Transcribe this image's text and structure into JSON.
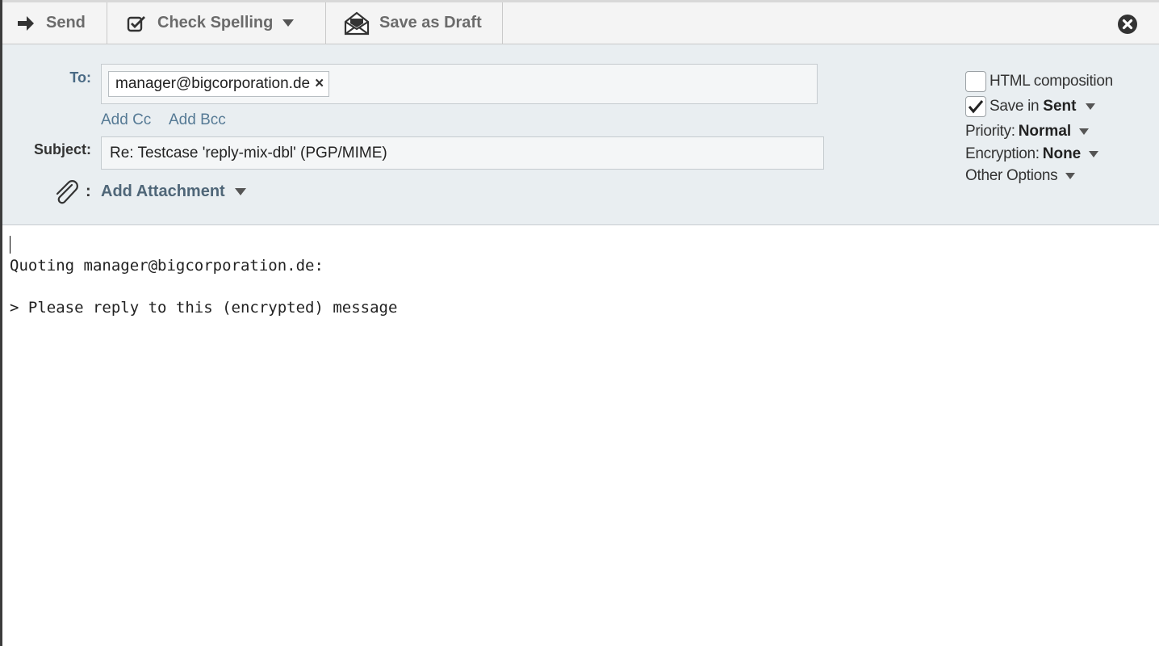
{
  "toolbar": {
    "send_label": "Send",
    "spell_label": "Check Spelling",
    "draft_label": "Save as Draft"
  },
  "header": {
    "to_label": "To:",
    "recipients": [
      "manager@bigcorporation.de"
    ],
    "remove_glyph": "×",
    "add_cc": "Add Cc",
    "add_bcc": "Add Bcc",
    "subject_label": "Subject:",
    "subject_value": "Re: Testcase 'reply-mix-dbl' (PGP/MIME)",
    "attach_colon": ":",
    "add_attachment": "Add Attachment"
  },
  "options": {
    "html_composition": "HTML composition",
    "html_checked": false,
    "save_in_prefix": "Save in ",
    "save_in_folder": "Sent",
    "save_checked": true,
    "priority_label": "Priority:",
    "priority_value": "Normal",
    "encryption_label": "Encryption:",
    "encryption_value": "None",
    "other_options": "Other Options"
  },
  "body": {
    "lines": [
      "Quoting manager@bigcorporation.de:",
      "> Please reply to this (encrypted) message"
    ]
  },
  "icons": {
    "send": "arrow-right-icon",
    "spell": "check-square-icon",
    "draft": "envelope-open-icon",
    "close": "close-circle-icon",
    "attach": "paperclip-icon"
  }
}
